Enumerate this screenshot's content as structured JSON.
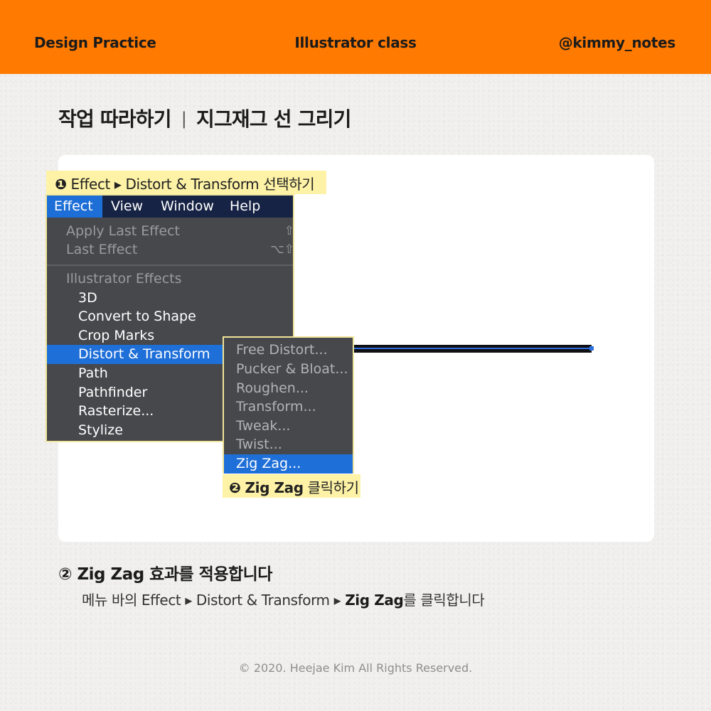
{
  "header": {
    "left": "Design Practice",
    "center": "Illustrator class",
    "right": "@kimmy_notes",
    "background_color": "#ff7a00"
  },
  "title": {
    "main": "작업 따라하기",
    "separator": "|",
    "sub": "지그재그 선 그리기"
  },
  "callouts": {
    "step1": {
      "marker": "❶",
      "text": "Effect ▸ Distort & Transform 선택하기"
    },
    "step2": {
      "marker": "❷",
      "bold": "Zig Zag",
      "text": " 클릭하기"
    }
  },
  "menubar": {
    "items": [
      "Effect",
      "View",
      "Window",
      "Help"
    ],
    "active": "Effect"
  },
  "effect_menu": {
    "apply_last": {
      "label": "Apply Last Effect",
      "shortcut": "⇧",
      "disabled": true
    },
    "last": {
      "label": "Last Effect",
      "shortcut": "⌥⇧",
      "disabled": true
    },
    "section_header": "Illustrator Effects",
    "items": [
      "3D",
      "Convert to Shape",
      "Crop Marks",
      "Distort & Transform",
      "Path",
      "Pathfinder",
      "Rasterize...",
      "Stylize"
    ],
    "selected": "Distort & Transform"
  },
  "submenu": {
    "items": [
      "Free Distort...",
      "Pucker & Bloat...",
      "Roughen...",
      "Transform...",
      "Tweak...",
      "Twist...",
      "Zig Zag..."
    ],
    "selected": "Zig Zag..."
  },
  "step": {
    "title": "② Zig Zag 효과를 적용합니다",
    "desc_prefix": "메뉴 바의 Effect ▸ Distort & Transform ▸ ",
    "desc_bold": "Zig Zag",
    "desc_suffix": "를 클릭합니다"
  },
  "footer": "© 2020. Heejae Kim All Rights Reserved.",
  "colors": {
    "accent_orange": "#ff7a00",
    "menu_background": "#46484b",
    "menubar_background": "#172345",
    "selection_blue": "#1f6fd8",
    "callout_yellow": "#fdf2a6"
  }
}
